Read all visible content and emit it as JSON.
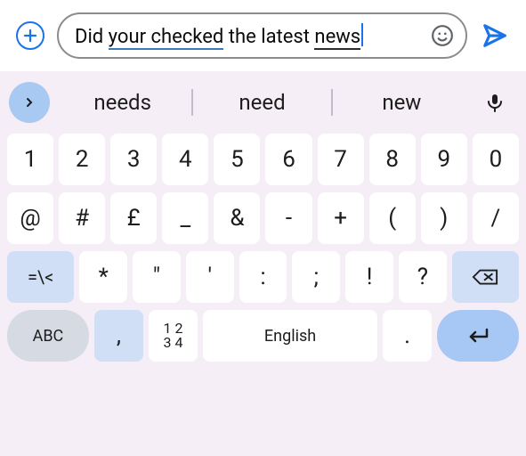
{
  "input": {
    "parts": {
      "p0": "Did ",
      "p1": "your checked",
      "p2": " the latest ",
      "p3": "news"
    }
  },
  "suggestions": {
    "s0": "needs",
    "s1": "need",
    "s2": "new"
  },
  "rows": {
    "r0": {
      "k0": "1",
      "k1": "2",
      "k2": "3",
      "k3": "4",
      "k4": "5",
      "k5": "6",
      "k6": "7",
      "k7": "8",
      "k8": "9",
      "k9": "0"
    },
    "r1": {
      "k0": "@",
      "k1": "#",
      "k2": "£",
      "k3": "_",
      "k4": "&",
      "k5": "-",
      "k6": "+",
      "k7": "(",
      "k8": ")",
      "k9": "/"
    },
    "r2": {
      "sym": "=\\<",
      "k0": "*",
      "k1": "\"",
      "k2": "'",
      "k3": ":",
      "k4": ";",
      "k5": "!",
      "k6": "?"
    },
    "r3": {
      "abc": "ABC",
      "comma": ",",
      "numpad_top": "1 2",
      "numpad_bot": "3 4",
      "space": "English",
      "dot": "."
    }
  }
}
